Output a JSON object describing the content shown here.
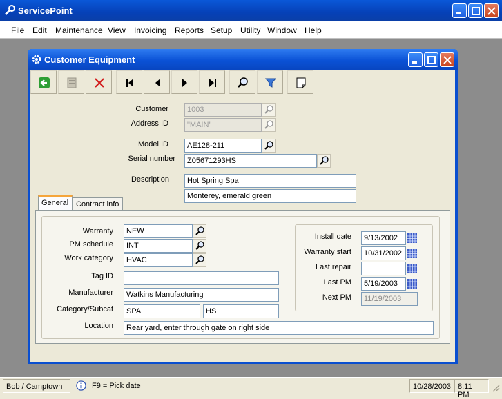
{
  "app": {
    "title": "ServicePoint"
  },
  "menu": [
    "File",
    "Edit",
    "Maintenance",
    "View",
    "Invoicing",
    "Reports",
    "Setup",
    "Utility",
    "Window",
    "Help"
  ],
  "window": {
    "title": "Customer Equipment"
  },
  "header_fields": {
    "customer": {
      "label": "Customer",
      "value": "1003"
    },
    "address_id": {
      "label": "Address ID",
      "value": "\"MAIN\""
    },
    "model_id": {
      "label": "Model ID",
      "value": "AE128-211"
    },
    "serial_number": {
      "label": "Serial number",
      "value": "Z05671293HS"
    },
    "description": {
      "label": "Description",
      "line1": "Hot Spring Spa",
      "line2": "Monterey, emerald green"
    }
  },
  "tabs": [
    "General",
    "Contract info"
  ],
  "general": {
    "warranty": {
      "label": "Warranty",
      "value": "NEW"
    },
    "pm_schedule": {
      "label": "PM schedule",
      "value": "INT"
    },
    "work_category": {
      "label": "Work category",
      "value": "HVAC"
    },
    "tag_id": {
      "label": "Tag ID",
      "value": ""
    },
    "manufacturer": {
      "label": "Manufacturer",
      "value": "Watkins Manufacturing"
    },
    "category_subcat": {
      "label": "Category/Subcat",
      "category": "SPA",
      "subcat": "HS"
    },
    "location": {
      "label": "Location",
      "value": "Rear yard, enter through gate on right side"
    }
  },
  "dates": {
    "install_date": {
      "label": "Install date",
      "value": "9/13/2002"
    },
    "warranty_start": {
      "label": "Warranty start",
      "value": "10/31/2002"
    },
    "last_repair": {
      "label": "Last repair",
      "value": ""
    },
    "last_pm": {
      "label": "Last PM",
      "value": "5/19/2003"
    },
    "next_pm": {
      "label": "Next PM",
      "value": "11/19/2003"
    }
  },
  "status": {
    "user": "Bob / Camptown",
    "hint": "F9 = Pick date",
    "date": "10/28/2003",
    "time": "8:11 PM"
  }
}
